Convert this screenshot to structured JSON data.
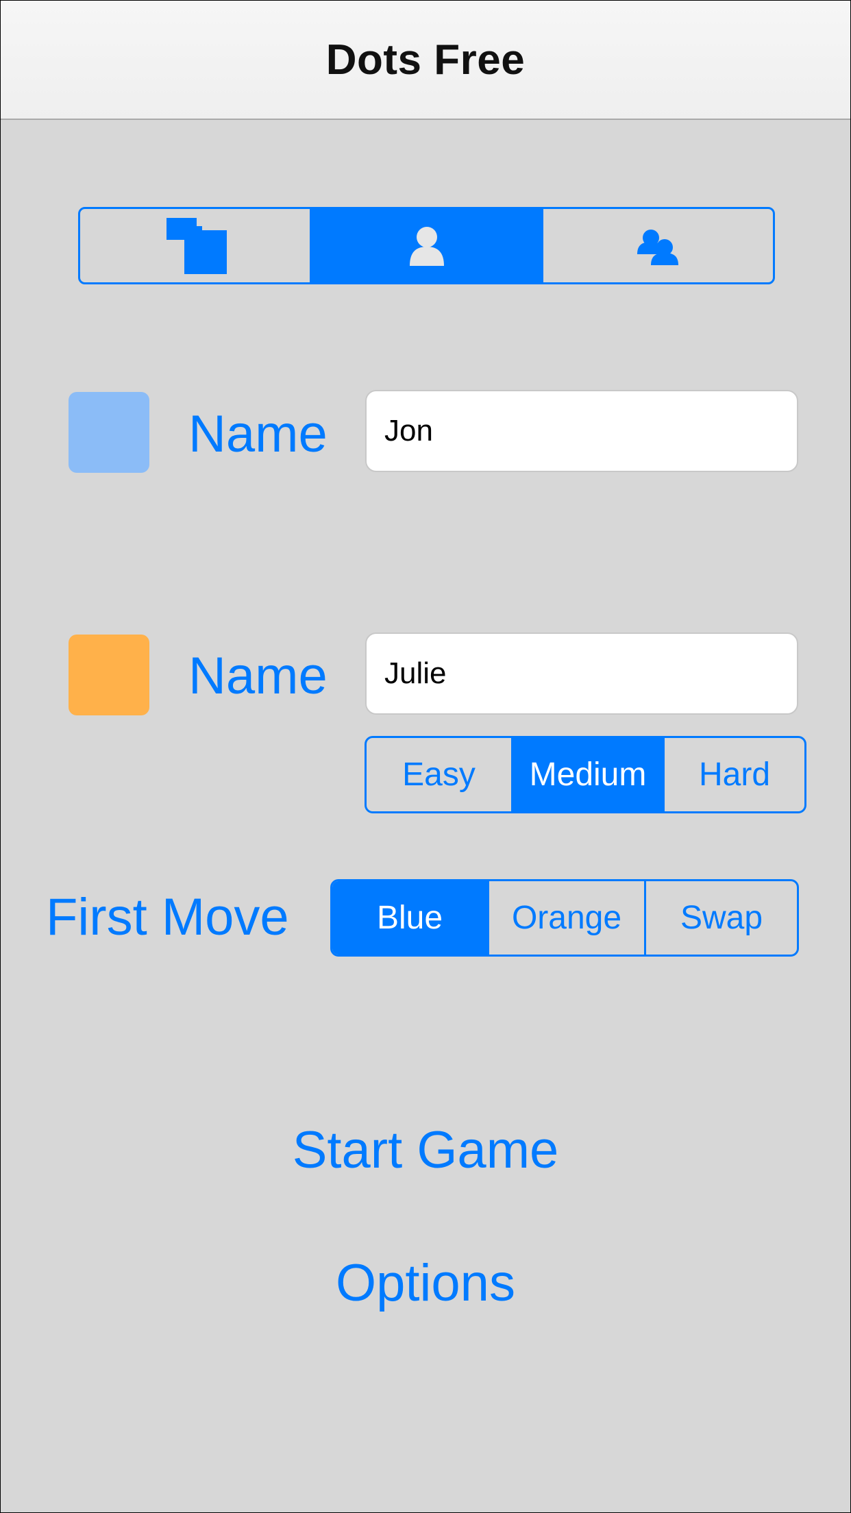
{
  "app": {
    "title": "Dots Free"
  },
  "mode_selector": {
    "options": [
      {
        "icon": "local-multiplayer-icon",
        "selected": false
      },
      {
        "icon": "single-player-icon",
        "selected": true
      },
      {
        "icon": "online-multiplayer-icon",
        "selected": false
      }
    ]
  },
  "players": [
    {
      "swatch_color": "#8bbcf7",
      "label": "Name",
      "value": "Jon"
    },
    {
      "swatch_color": "#ffb14a",
      "label": "Name",
      "value": "Julie"
    }
  ],
  "difficulty": {
    "options": [
      "Easy",
      "Medium",
      "Hard"
    ],
    "selected": "Medium"
  },
  "first_move": {
    "label": "First Move",
    "options": [
      "Blue",
      "Orange",
      "Swap"
    ],
    "selected": "Blue"
  },
  "actions": {
    "start_game": "Start Game",
    "options": "Options"
  },
  "colors": {
    "accent": "#007aff",
    "background": "#d7d7d7"
  }
}
